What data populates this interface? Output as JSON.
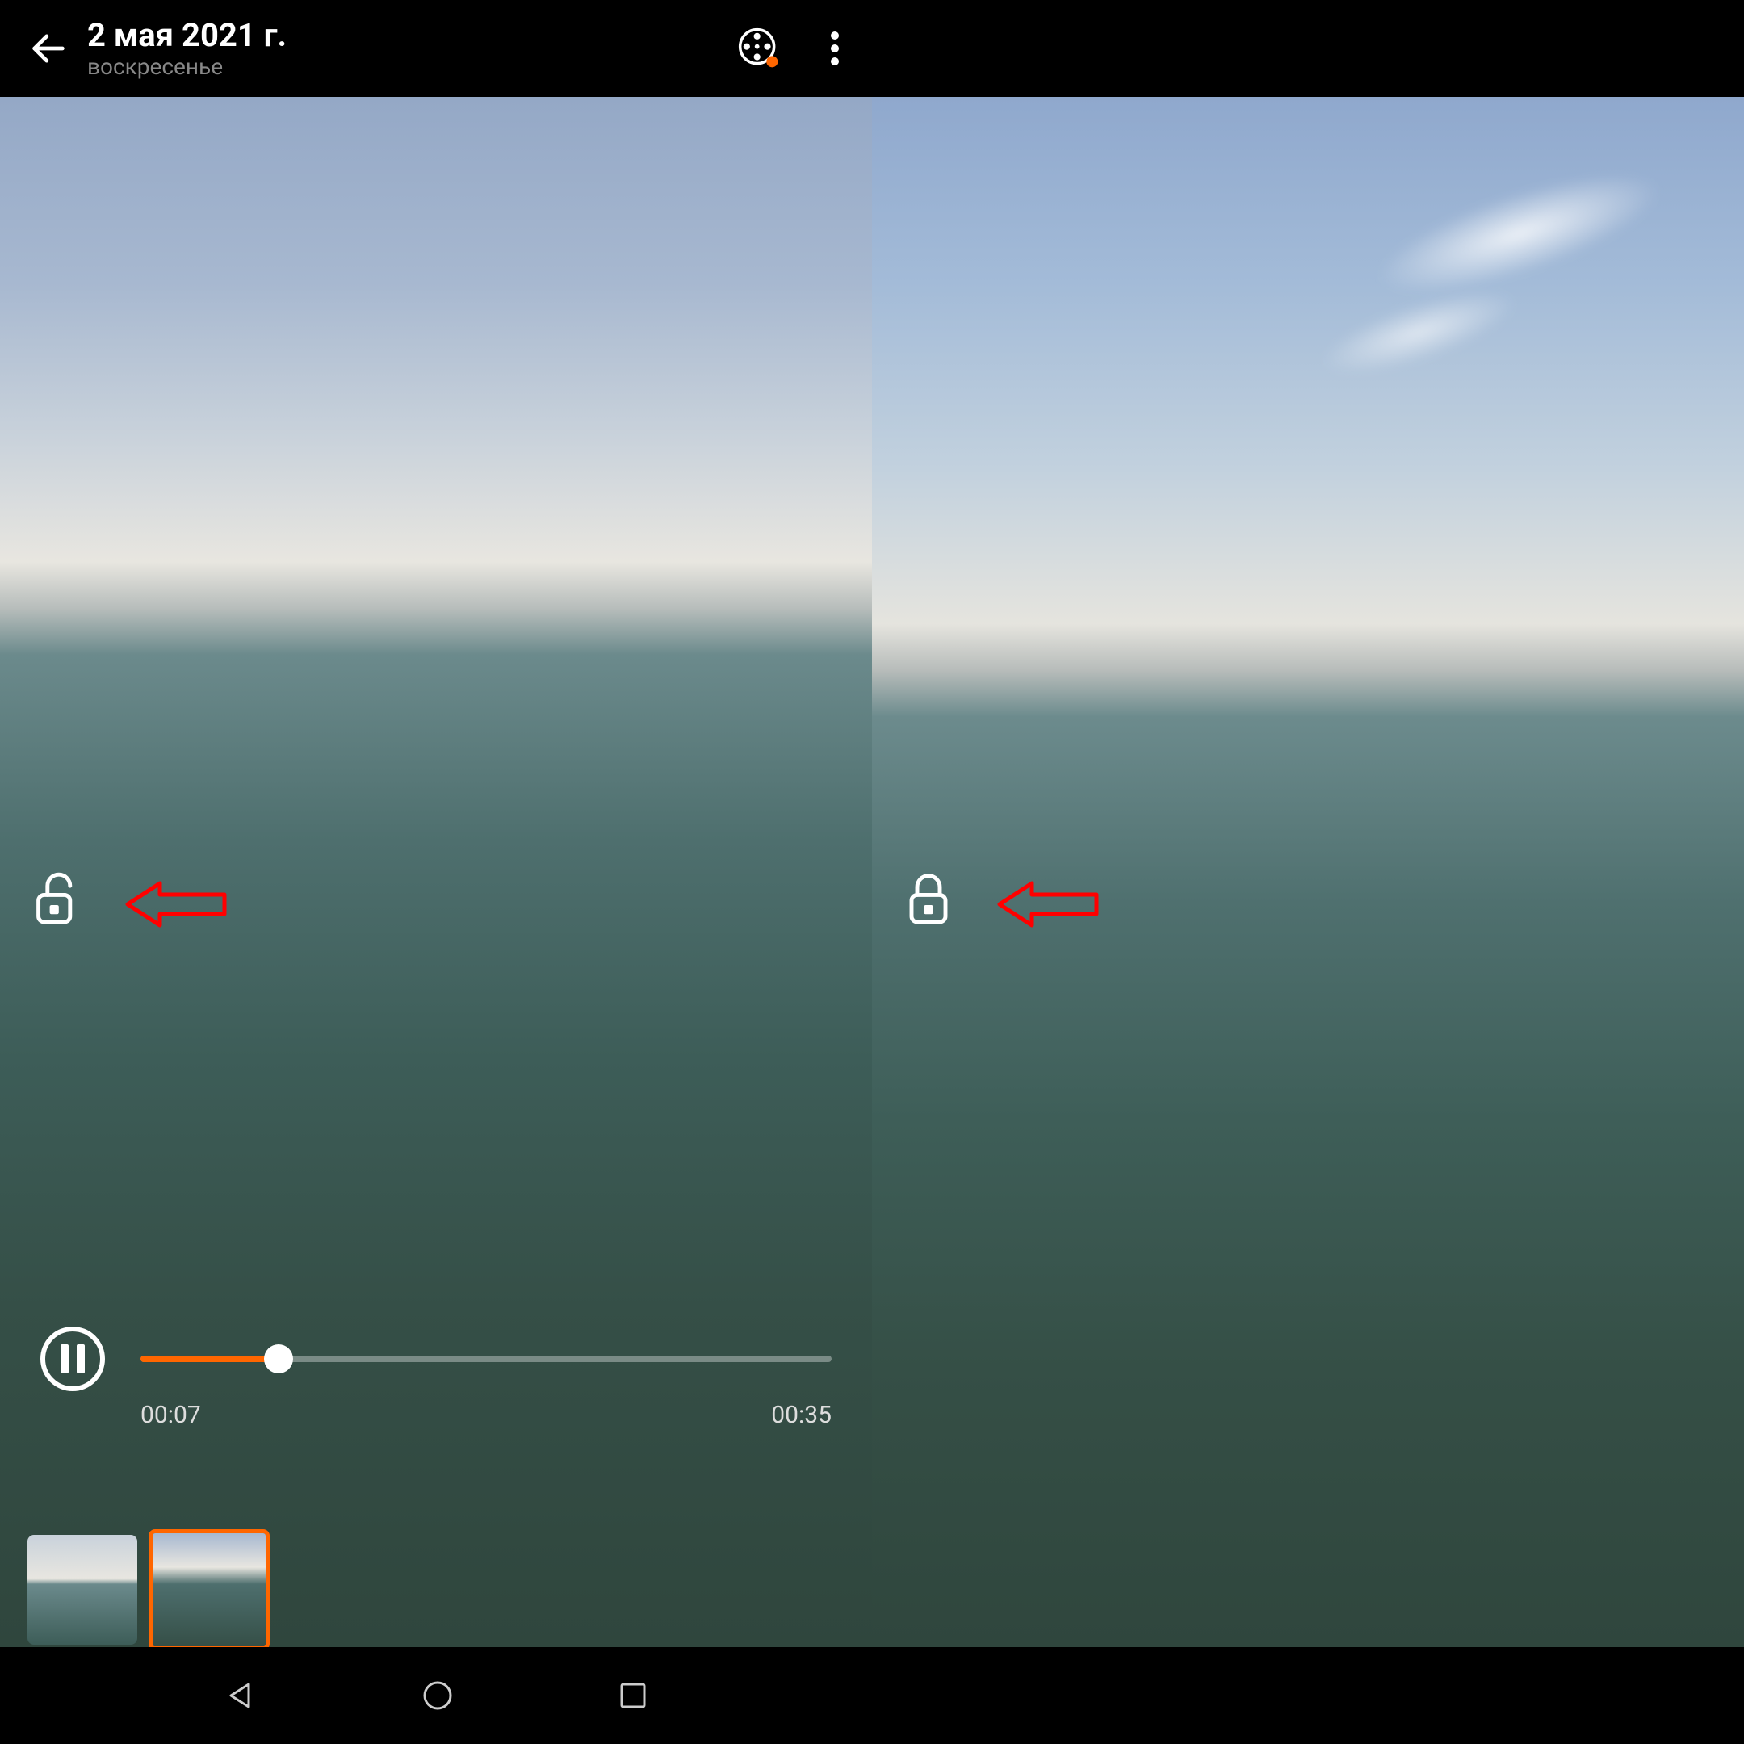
{
  "header": {
    "date_title": "2 мая 2021 г.",
    "day_subtitle": "воскресенье"
  },
  "player": {
    "current_time": "00:07",
    "total_time": "00:35",
    "progress_percent": 20
  },
  "annotations": {
    "left_lock_state": "unlocked",
    "right_lock_state": "locked"
  },
  "colors": {
    "accent": "#ff6600",
    "annotation_red": "#ff0000"
  }
}
